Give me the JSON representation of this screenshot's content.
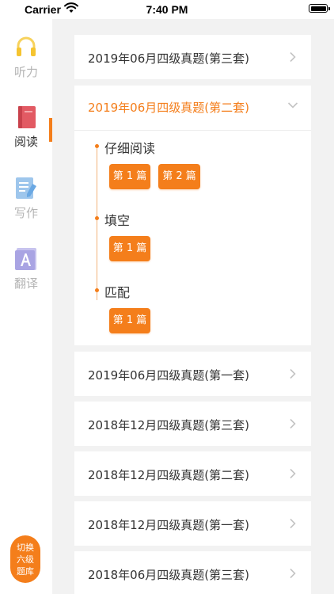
{
  "status_bar": {
    "carrier": "Carrier",
    "time": "7:40 PM"
  },
  "sidebar": {
    "items": [
      {
        "label": "听力",
        "icon": "headphones-icon"
      },
      {
        "label": "阅读",
        "icon": "book-icon"
      },
      {
        "label": "写作",
        "icon": "document-pen-icon"
      },
      {
        "label": "翻译",
        "icon": "translate-letter-icon"
      }
    ],
    "active_index": 1,
    "switch_button": {
      "line1": "切换",
      "line2": "六级",
      "line3": "题库"
    }
  },
  "papers": [
    {
      "title": "2019年06月四级真题(第三套)",
      "expanded": false
    },
    {
      "title": "2019年06月四级真题(第二套)",
      "expanded": true,
      "sections": [
        {
          "name": "仔细阅读",
          "chips": [
            "第 1 篇",
            "第 2 篇"
          ]
        },
        {
          "name": "填空",
          "chips": [
            "第 1 篇"
          ]
        },
        {
          "name": "匹配",
          "chips": [
            "第 1 篇"
          ]
        }
      ]
    },
    {
      "title": "2019年06月四级真题(第一套)",
      "expanded": false
    },
    {
      "title": "2018年12月四级真题(第三套)",
      "expanded": false
    },
    {
      "title": "2018年12月四级真题(第二套)",
      "expanded": false
    },
    {
      "title": "2018年12月四级真题(第一套)",
      "expanded": false
    },
    {
      "title": "2018年06月四级真题(第三套)",
      "expanded": false
    }
  ],
  "colors": {
    "accent": "#f47e1b",
    "inactive_text": "#b4b4b4",
    "background": "#f2f2f2"
  }
}
